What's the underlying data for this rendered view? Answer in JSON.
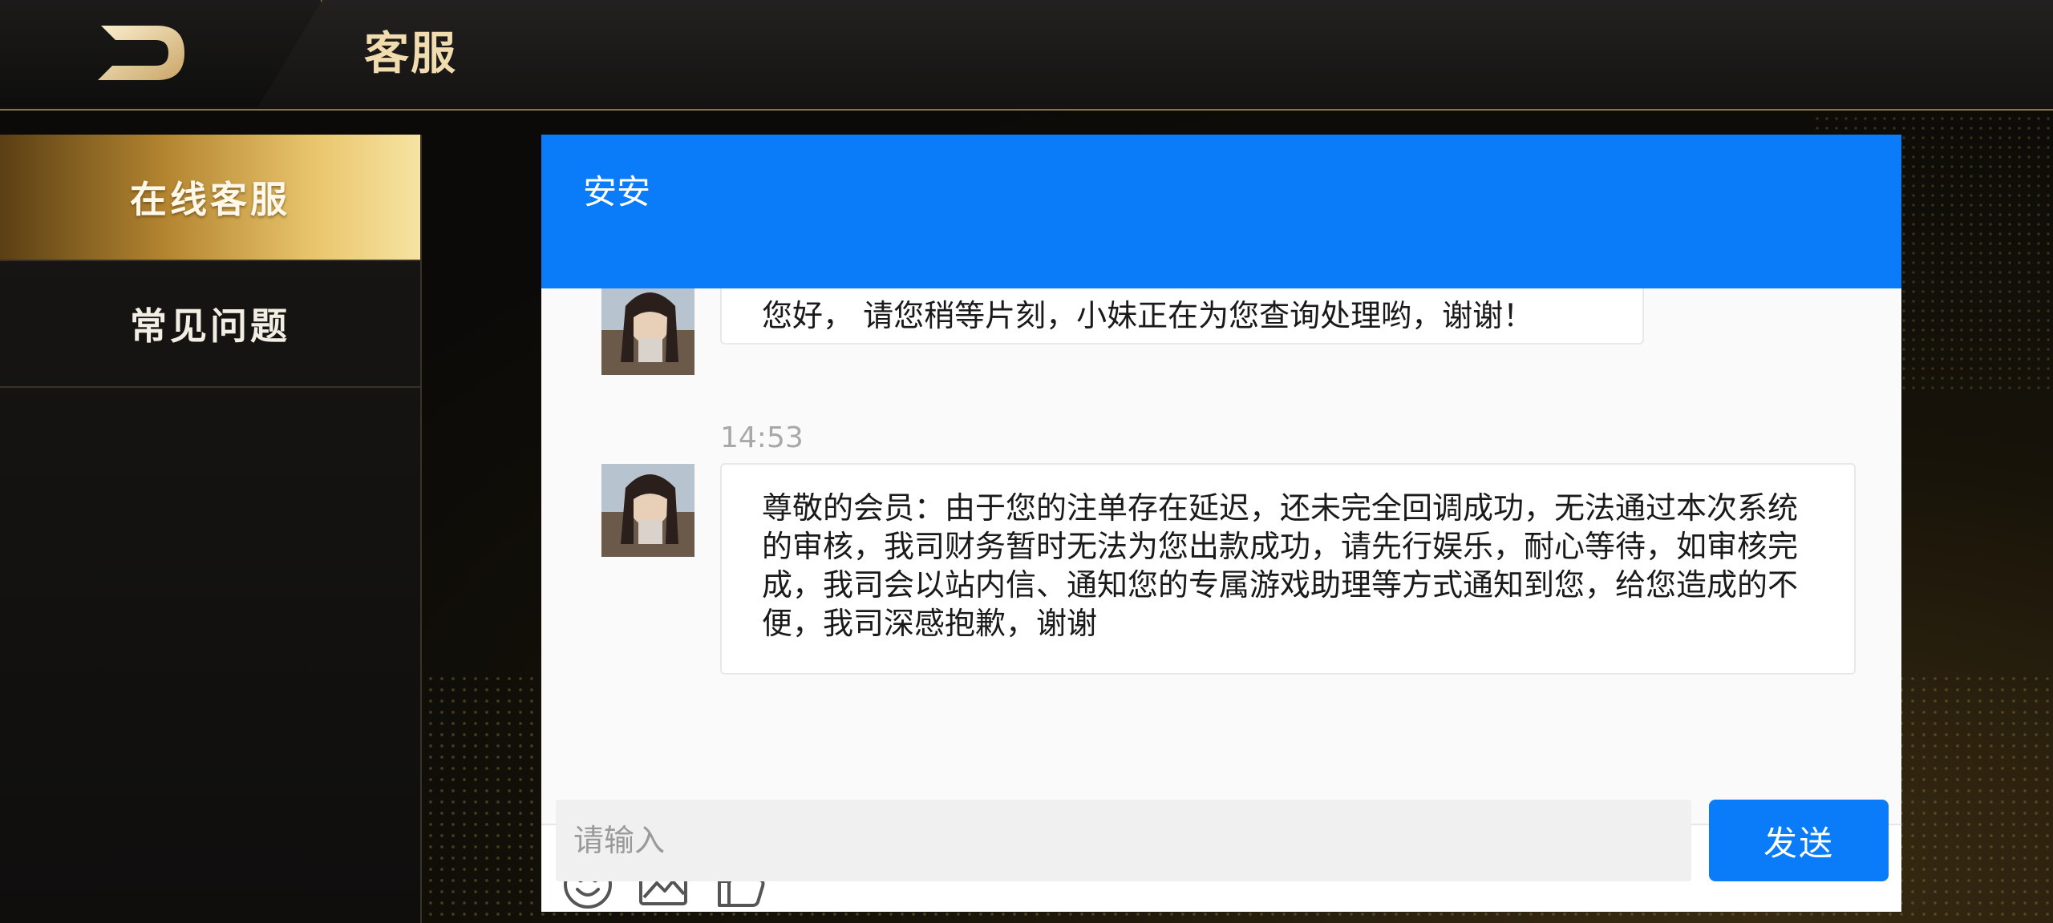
{
  "header": {
    "title": "客服",
    "back_icon": "back-arrow-icon"
  },
  "sidebar": {
    "items": [
      {
        "label": "在线客服",
        "active": true
      },
      {
        "label": "常见问题",
        "active": false
      }
    ]
  },
  "chat": {
    "agent_name": "安安",
    "messages": [
      {
        "sender": "agent",
        "time": "",
        "text": "您好， 请您稍等片刻，小妹正在为您查询处理哟，谢谢！"
      },
      {
        "sender": "agent",
        "time": "14:53",
        "text": "尊敬的会员：由于您的注单存在延迟，还未完全回调成功，无法通过本次系统的审核，我司财务暂时无法为您出款成功，请先行娱乐，耐心等待，如审核完成，我司会以站内信、通知您的专属游戏助理等方式通知到您，给您造成的不便，我司深感抱歉，谢谢"
      }
    ],
    "toolbar_icons": [
      "emoji-icon",
      "image-icon",
      "thumbs-up-icon"
    ],
    "input_placeholder": "请输入",
    "send_label": "发送"
  },
  "colors": {
    "accent_blue": "#0a7cfa",
    "gold": "#f0dcae"
  }
}
